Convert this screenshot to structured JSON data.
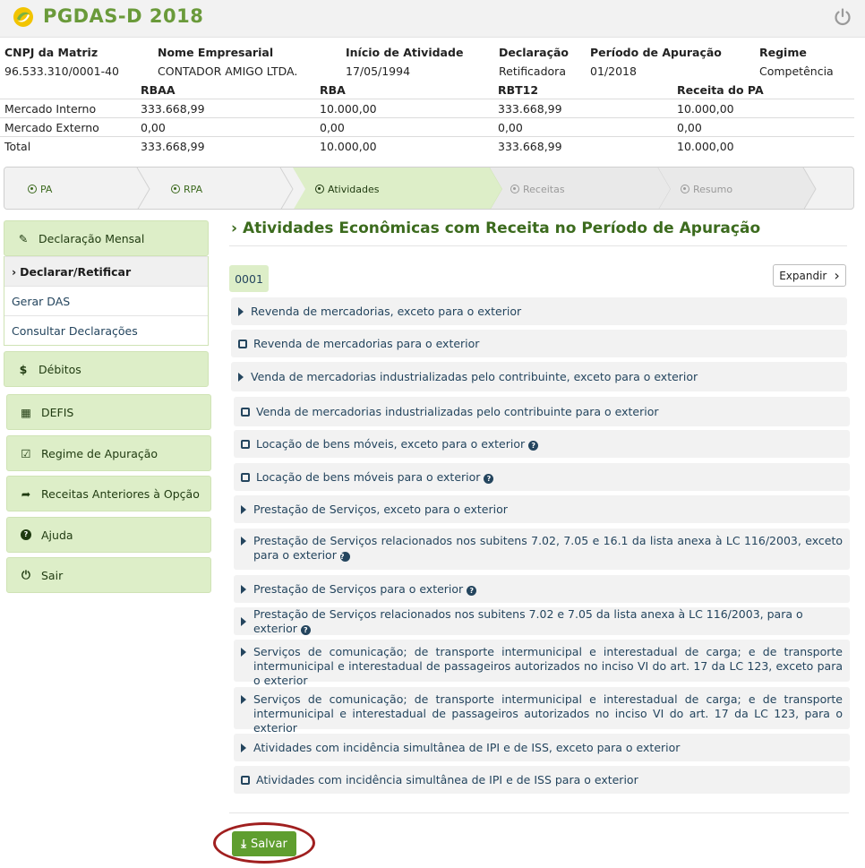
{
  "app": {
    "title": "PGDAS-D 2018"
  },
  "company": {
    "headers": [
      "CNPJ da Matriz",
      "Nome Empresarial",
      "Início de Atividade",
      "Declaração",
      "Período de Apuração",
      "Regime"
    ],
    "values": [
      "96.533.310/0001-40",
      "CONTADOR AMIGO LTDA.",
      "17/05/1994",
      "Retificadora",
      "01/2018",
      "Competência"
    ]
  },
  "revenue": {
    "headers": [
      "RBAA",
      "RBA",
      "RBT12",
      "Receita do PA"
    ],
    "rows": [
      {
        "label": "Mercado Interno",
        "values": [
          "333.668,99",
          "10.000,00",
          "333.668,99",
          "10.000,00"
        ]
      },
      {
        "label": "Mercado Externo",
        "values": [
          "0,00",
          "0,00",
          "0,00",
          "0,00"
        ]
      },
      {
        "label": "Total",
        "values": [
          "333.668,99",
          "10.000,00",
          "333.668,99",
          "10.000,00"
        ]
      }
    ]
  },
  "steps": [
    {
      "label": "PA",
      "state": "done"
    },
    {
      "label": "RPA",
      "state": "done"
    },
    {
      "label": "Atividades",
      "state": "active"
    },
    {
      "label": "Receitas",
      "state": "pending"
    },
    {
      "label": "Resumo",
      "state": "pending"
    }
  ],
  "sidebar": {
    "declaracao_mensal": "Declaração Mensal",
    "sub": [
      "Declarar/Retificar",
      "Gerar DAS",
      "Consultar Declarações"
    ],
    "debitos": "Débitos",
    "defis": "DEFIS",
    "regime": "Regime de Apuração",
    "receitas_anteriores": "Receitas Anteriores à Opção",
    "ajuda": "Ajuda",
    "sair": "Sair"
  },
  "main": {
    "title": "Atividades Econômicas com Receita no Período de Apuração",
    "code": "0001",
    "expand_label": "Expandir",
    "activities": [
      {
        "text": "Revenda de mercadorias, exceto para o exterior",
        "kind": "expand",
        "help": false
      },
      {
        "text": "Revenda de mercadorias para o exterior",
        "kind": "check",
        "help": false
      },
      {
        "text": "Venda de mercadorias industrializadas pelo contribuinte, exceto para o exterior",
        "kind": "expand",
        "help": false
      },
      {
        "text": "Venda de mercadorias industrializadas pelo contribuinte para o exterior",
        "kind": "check",
        "help": false
      },
      {
        "text": "Locação de bens móveis, exceto para o exterior",
        "kind": "check",
        "help": true
      },
      {
        "text": "Locação de bens móveis para o exterior",
        "kind": "check",
        "help": true
      },
      {
        "text": "Prestação de Serviços, exceto para o exterior",
        "kind": "expand",
        "help": false
      },
      {
        "text": "Prestação de Serviços relacionados nos subitens 7.02, 7.05 e 16.1 da lista anexa à LC 116/2003, exceto para o exterior",
        "kind": "expand",
        "help": true
      },
      {
        "text": "Prestação de Serviços para o exterior",
        "kind": "expand",
        "help": true
      },
      {
        "text": "Prestação de Serviços relacionados nos subitens 7.02 e 7.05 da lista anexa à LC 116/2003, para o exterior",
        "kind": "expand",
        "help": true
      },
      {
        "text": "Serviços de comunicação; de transporte intermunicipal e interestadual de carga; e de transporte intermunicipal e interestadual de passageiros autorizados no inciso VI do art. 17 da LC 123, exceto para o exterior",
        "kind": "expand",
        "help": false
      },
      {
        "text": "Serviços de comunicação; de transporte intermunicipal e interestadual de carga; e de transporte intermunicipal e interestadual de passageiros autorizados no inciso VI do art. 17 da LC 123, para o exterior",
        "kind": "expand",
        "help": false
      },
      {
        "text": "Atividades com incidência simultânea de IPI e de ISS, exceto para o exterior",
        "kind": "expand",
        "help": false
      },
      {
        "text": "Atividades com incidência simultânea de IPI e de ISS para o exterior",
        "kind": "check",
        "help": false
      }
    ],
    "save_label": "Salvar"
  },
  "colors": {
    "brand_green": "#6a9a3a",
    "title_green": "#3c6b1e",
    "light_green": "#ddeec8",
    "save_green": "#5f9e2f",
    "text_blue": "#24455e",
    "highlight_ring": "#a01f1f"
  },
  "icons": {
    "logo": "receita-logo-icon",
    "power": "power-icon",
    "help": "question-circle-icon"
  }
}
